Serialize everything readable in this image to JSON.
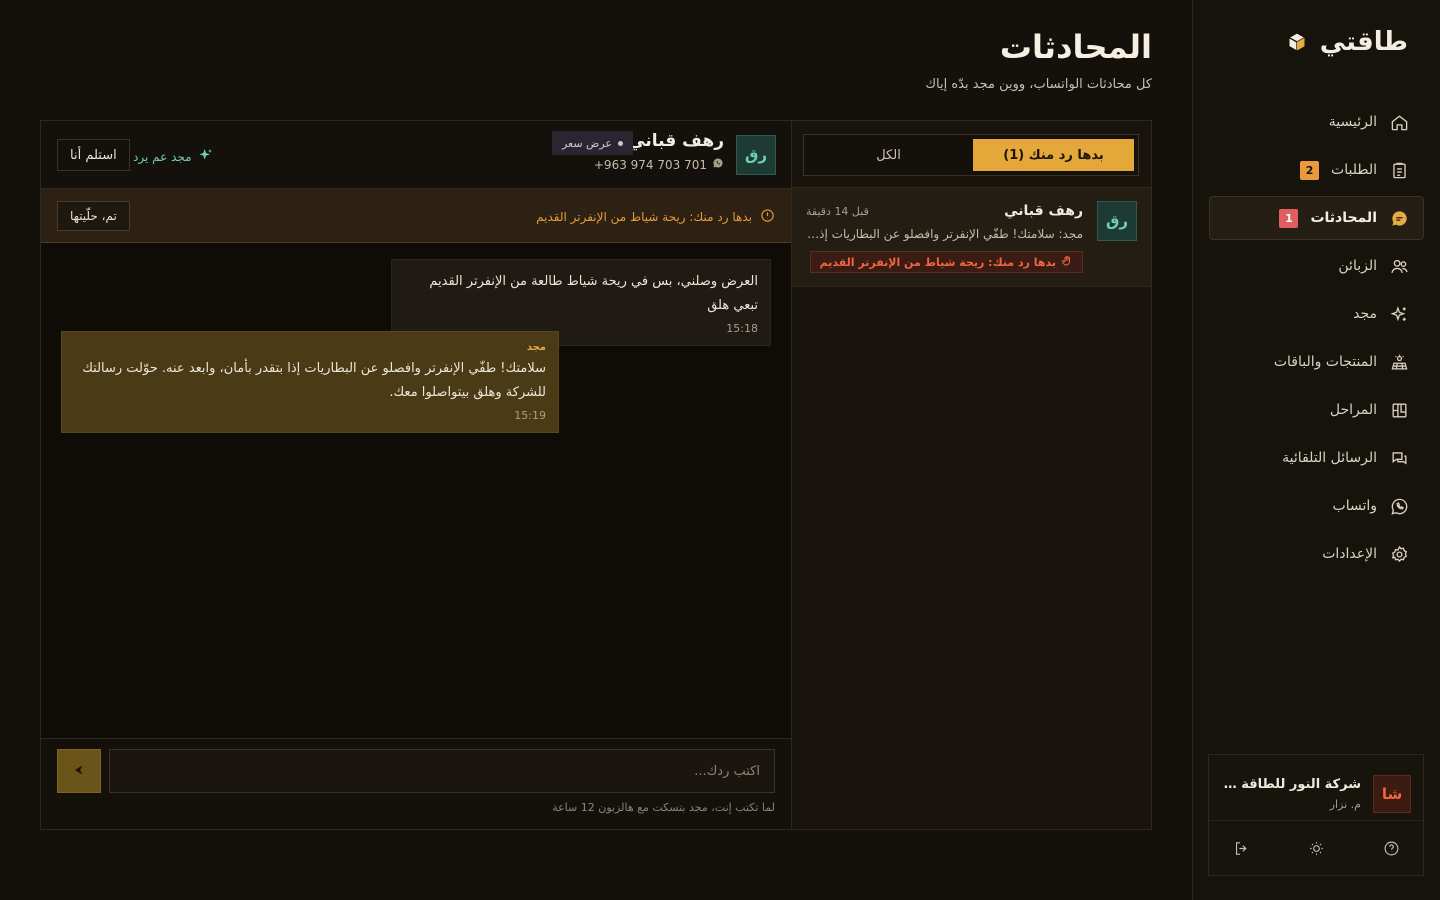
{
  "brand": {
    "name": "طاقتي"
  },
  "nav": {
    "items": [
      {
        "label": "الرئيسية",
        "badge": ""
      },
      {
        "label": "الطلبات",
        "badge": "2"
      },
      {
        "label": "المحادثات",
        "badge": "1"
      },
      {
        "label": "الزبائن",
        "badge": ""
      },
      {
        "label": "مجد",
        "badge": ""
      },
      {
        "label": "المنتجات والباقات",
        "badge": ""
      },
      {
        "label": "المراحل",
        "badge": ""
      },
      {
        "label": "الرسائل التلقائية",
        "badge": ""
      },
      {
        "label": "واتساب",
        "badge": ""
      },
      {
        "label": "الإعدادات",
        "badge": ""
      }
    ]
  },
  "org": {
    "avatar": "شا",
    "name": "شركة النور للطاقة الشمسية",
    "user": "م. نزار"
  },
  "header": {
    "title": "المحادثات",
    "subtitle": "كل محادثات الواتساب، ووين مجد بدّه إياك"
  },
  "tabs": {
    "needs_reply": "بدها رد منك (1)",
    "all": "الكل"
  },
  "conversation": {
    "avatar": "رق",
    "name": "رهف قباني",
    "time": "قبل 14 دقيقة",
    "preview_sender": "مجد:",
    "preview": "سلامتك! طفّي الإنفرتر وافصلو عن البطاريات إذا بتقدر بأمان، وابعد عنه.",
    "flag": "بدها رد منك: ريحة شياط من الإنفرتر القديم"
  },
  "chat": {
    "avatar": "رق",
    "name": "رهف قباني",
    "tag": "عرض سعر",
    "phone": "+963 974 703 701",
    "ai_status": "مجد عم يرد",
    "claim": "استلم أنا",
    "alert": "بدها رد منك: ريحة شياط من الإنفرتر القديم",
    "resolve": "تم، حلّيتها"
  },
  "messages": {
    "incoming": {
      "text": "العرض وصلني، بس في ريحة شياط طالعة من الإنفرتر القديم تبعي هلق",
      "time": "15:18"
    },
    "outgoing": {
      "sender": "مجد",
      "text": "سلامتك! طفّي الإنفرتر وافصلو عن البطاريات إذا بتقدر بأمان، وابعد عنه. حوّلت رسالتك للشركة وهلق بيتواصلوا معك.",
      "time": "15:19"
    }
  },
  "composer": {
    "placeholder": "اكتب ردك...",
    "note": "لما تكتب إنت، مجد بتسكت مع هالزبون 12 ساعة"
  },
  "colors": {
    "accent": "#e3a73a",
    "alert": "#e89a3c",
    "danger": "#f0663f",
    "ai": "#6fd0b6"
  }
}
